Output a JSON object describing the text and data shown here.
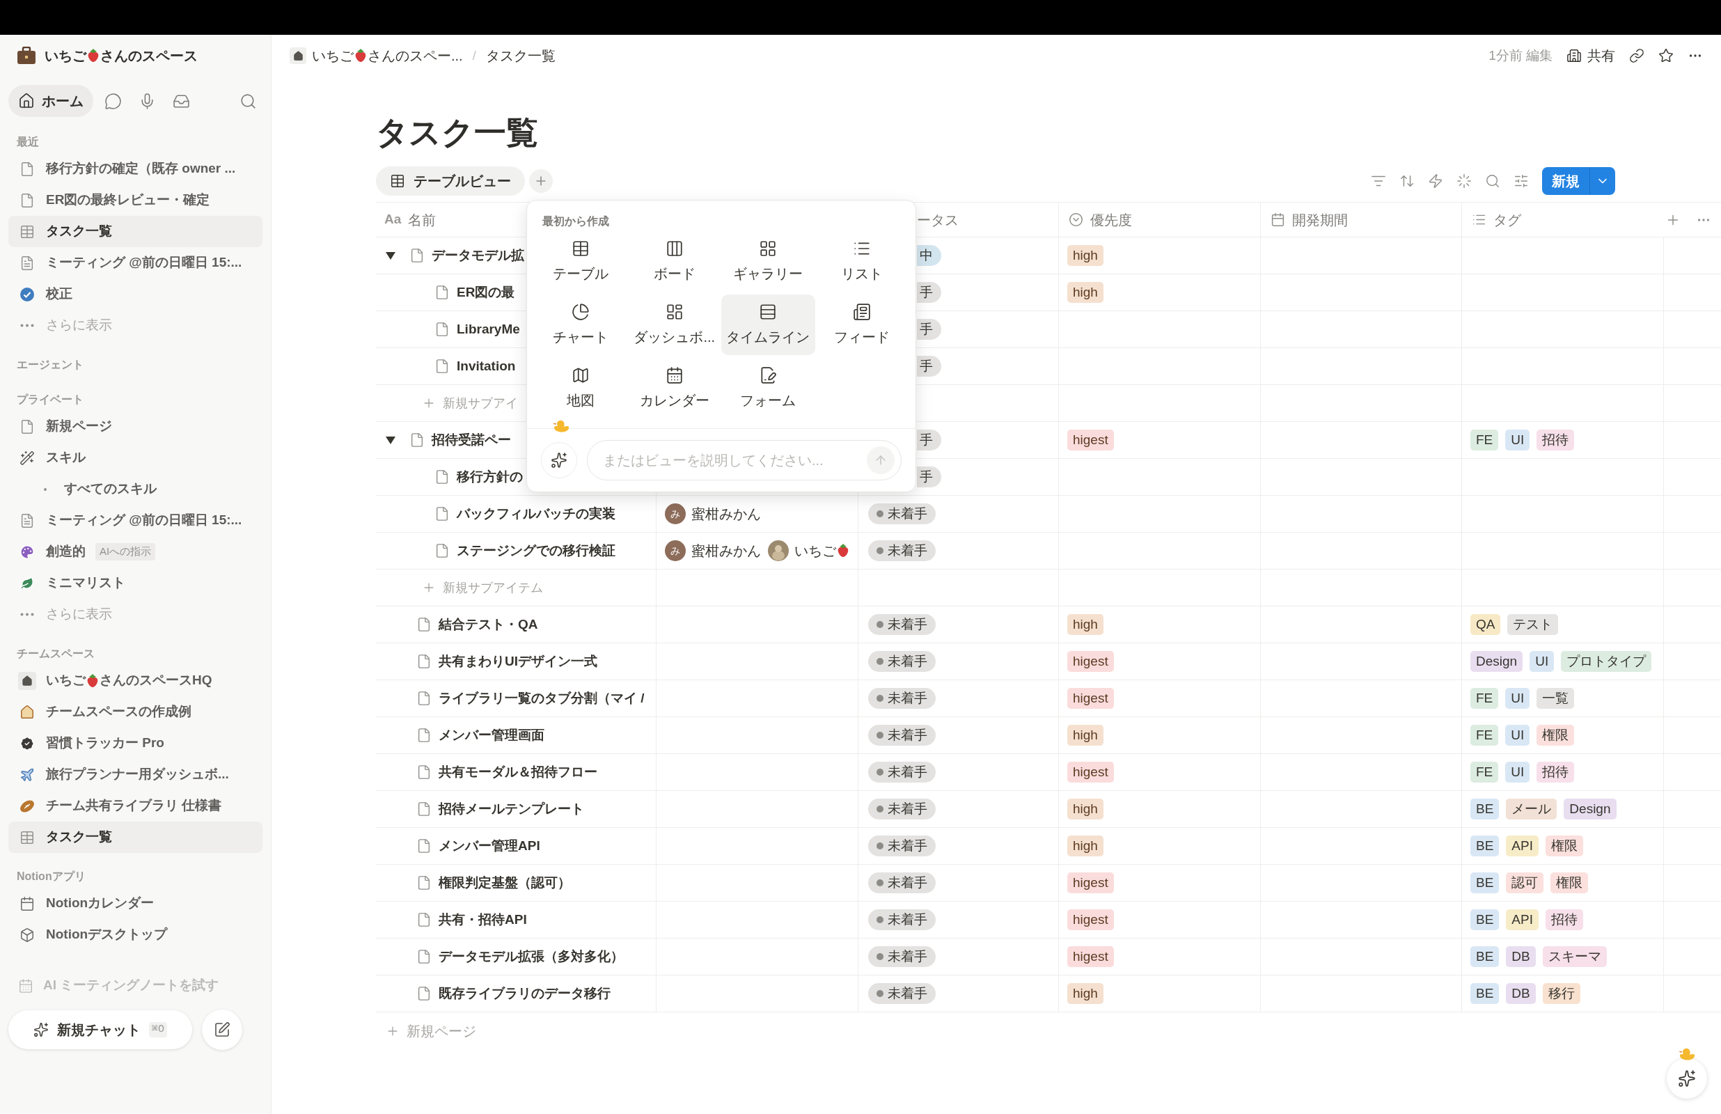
{
  "sidebar": {
    "workspace": {
      "label_parts": [
        "いちご",
        "さんのスペース"
      ]
    },
    "nav": [
      {
        "kind": "home",
        "label": "ホーム",
        "selected": true
      },
      {
        "kind": "chat",
        "selected": false
      },
      {
        "kind": "meeting",
        "selected": false
      },
      {
        "kind": "inbox",
        "selected": false
      },
      {
        "kind": "search",
        "selected": false
      }
    ],
    "sections": [
      {
        "heading": "最近",
        "items": [
          {
            "kind": "page",
            "label": "移行方針の確定（既存 owner ...",
            "selected": false
          },
          {
            "kind": "page",
            "label": "ER図の最終レビュー・確定",
            "selected": false
          },
          {
            "kind": "table",
            "label": "タスク一覧",
            "selected": true
          },
          {
            "kind": "meeting",
            "label": "ミーティング @前の日曜日 15:...",
            "selected": false
          },
          {
            "kind": "check",
            "label": "校正",
            "selected": false
          },
          {
            "kind": "more",
            "label": "さらに表示",
            "selected": false
          }
        ]
      },
      {
        "heading": "エージェント"
      },
      {
        "heading": "プライベート",
        "items": [
          {
            "kind": "page",
            "label": "新規ページ",
            "selected": false
          },
          {
            "kind": "skill",
            "label": "スキル",
            "selected": false
          },
          {
            "kind": "bullet",
            "label": "すべてのスキル",
            "selected": false
          },
          {
            "kind": "meeting",
            "label": "ミーティング @前の日曜日 15:...",
            "selected": false
          },
          {
            "kind": "palette",
            "label": "創造的",
            "badge": "AIへの指示",
            "selected": false
          },
          {
            "kind": "leaf",
            "label": "ミニマリスト",
            "selected": false
          },
          {
            "kind": "more",
            "label": "さらに表示",
            "selected": false
          }
        ]
      },
      {
        "heading": "チームスペース",
        "items": [
          {
            "kind": "home",
            "label_parts": [
              "いちご",
              "さんのスペースHQ"
            ],
            "selected": false
          },
          {
            "kind": "house",
            "label": "チームスペースの作成例",
            "selected": false
          },
          {
            "kind": "badge",
            "label": "習慣トラッカー Pro",
            "selected": false
          },
          {
            "kind": "plane",
            "label": "旅行プランナー用ダッシュボ...",
            "selected": false
          },
          {
            "kind": "football",
            "label": "チーム共有ライブラリ 仕様書",
            "selected": false
          },
          {
            "kind": "table",
            "label": "タスク一覧",
            "selected": true
          }
        ]
      },
      {
        "heading": "Notionアプリ",
        "items": [
          {
            "kind": "calendar",
            "label": "Notionカレンダー",
            "selected": false
          },
          {
            "kind": "app",
            "label": "Notionデスクトップ",
            "selected": false
          }
        ]
      }
    ],
    "ai_notes": {
      "label": "AI ミーティングノートを試す",
      "disabled": true
    },
    "new_chat": {
      "label": "新規チャット",
      "shortcut": "⌘O"
    }
  },
  "breadcrumb": {
    "separator": "/",
    "items": [
      {
        "kind": "workspace",
        "label_parts": [
          "いちご",
          "さんのスペー..."
        ]
      },
      {
        "kind": "page",
        "label": "タスク一覧"
      }
    ]
  },
  "header_actions": {
    "edited": "1分前 編集",
    "share": "共有"
  },
  "page_title": "タスク一覧",
  "views": [
    {
      "label": "テーブルビュー",
      "selected": true
    }
  ],
  "new_button": "新規",
  "columns": [
    {
      "kind": "title",
      "icon_text": "Aa",
      "label": "名前"
    },
    {
      "kind": "person"
    },
    {
      "kind": "status",
      "label": "ータス"
    },
    {
      "kind": "select",
      "label": "優先度"
    },
    {
      "kind": "date",
      "label": "開発期間"
    },
    {
      "kind": "multi",
      "label": "タグ"
    }
  ],
  "rows": [
    {
      "kind": "group",
      "expanded": true,
      "under_popup": true,
      "name": "データモデル拡",
      "status": {
        "label": "中",
        "color": "#d3e5ef"
      },
      "priority": {
        "label": "high",
        "color": "#f5e0cf"
      }
    },
    {
      "kind": "child",
      "under_popup": true,
      "name": "ER図の最",
      "status": {
        "label": "手",
        "color": "#e3e2e0"
      },
      "priority": {
        "label": "high",
        "color": "#f5e0cf"
      }
    },
    {
      "kind": "child",
      "under_popup": true,
      "name": "LibraryMe",
      "status": {
        "label": "手",
        "color": "#e3e2e0"
      }
    },
    {
      "kind": "child",
      "under_popup": true,
      "name": "Invitation",
      "status": {
        "label": "手",
        "color": "#e3e2e0"
      }
    },
    {
      "kind": "add",
      "name": "新規サブアイ"
    },
    {
      "kind": "group",
      "expanded": true,
      "under_popup": true,
      "name": "招待受諾ペー",
      "status": {
        "label": "手",
        "color": "#e3e2e0"
      },
      "priority": {
        "label": "higest",
        "color": "#fbdcdc"
      },
      "tags": [
        {
          "label": "FE",
          "color": "#dcece0"
        },
        {
          "label": "UI",
          "color": "#d9e7f5"
        },
        {
          "label": "招待",
          "color": "#f7e0ea"
        }
      ]
    },
    {
      "kind": "child",
      "under_popup": true,
      "name": "移行方針の",
      "status": {
        "label": "手",
        "color": "#e3e2e0"
      }
    },
    {
      "kind": "child",
      "under_popup": false,
      "name": "バックフィルバッチの実装",
      "assignees": [
        {
          "kind": "initial",
          "initial": "み",
          "name": "蜜柑みかん"
        }
      ],
      "status": {
        "label": "未着手",
        "color": "#e3e2e0"
      }
    },
    {
      "kind": "child",
      "under_popup": false,
      "name": "ステージングでの移行検証",
      "assignees": [
        {
          "kind": "initial",
          "initial": "み",
          "name": "蜜柑みかん"
        },
        {
          "kind": "photo",
          "name_parts": [
            "いちご"
          ],
          "emoji_after": true
        }
      ],
      "status": {
        "label": "未着手",
        "color": "#e3e2e0"
      }
    },
    {
      "kind": "add",
      "name": "新規サブアイテム"
    },
    {
      "kind": "page",
      "under_popup": false,
      "name": "結合テスト・QA",
      "status": {
        "label": "未着手",
        "color": "#e3e2e0"
      },
      "priority": {
        "label": "high",
        "color": "#f5e0cf"
      },
      "tags": [
        {
          "label": "QA",
          "color": "#f7e9c5"
        },
        {
          "label": "テスト",
          "color": "#e6e5e3"
        }
      ]
    },
    {
      "kind": "page",
      "under_popup": false,
      "name": "共有まわりUIデザイン一式",
      "status": {
        "label": "未着手",
        "color": "#e3e2e0"
      },
      "priority": {
        "label": "higest",
        "color": "#fbdcdc"
      },
      "tags": [
        {
          "label": "Design",
          "color": "#e8def0"
        },
        {
          "label": "UI",
          "color": "#d9e7f5"
        },
        {
          "label": "プロトタイプ",
          "color": "#dcece0"
        }
      ]
    },
    {
      "kind": "page",
      "under_popup": false,
      "name": "ライブラリ一覧のタブ分割（マイ /",
      "status": {
        "label": "未着手",
        "color": "#e3e2e0"
      },
      "priority": {
        "label": "higest",
        "color": "#fbdcdc"
      },
      "tags": [
        {
          "label": "FE",
          "color": "#dcece0"
        },
        {
          "label": "UI",
          "color": "#d9e7f5"
        },
        {
          "label": "一覧",
          "color": "#e6e5e3"
        }
      ]
    },
    {
      "kind": "page",
      "under_popup": false,
      "name": "メンバー管理画面",
      "status": {
        "label": "未着手",
        "color": "#e3e2e0"
      },
      "priority": {
        "label": "high",
        "color": "#f5e0cf"
      },
      "tags": [
        {
          "label": "FE",
          "color": "#dcece0"
        },
        {
          "label": "UI",
          "color": "#d9e7f5"
        },
        {
          "label": "権限",
          "color": "#fbe0dd"
        }
      ]
    },
    {
      "kind": "page",
      "under_popup": false,
      "name": "共有モーダル＆招待フロー",
      "status": {
        "label": "未着手",
        "color": "#e3e2e0"
      },
      "priority": {
        "label": "higest",
        "color": "#fbdcdc"
      },
      "tags": [
        {
          "label": "FE",
          "color": "#dcece0"
        },
        {
          "label": "UI",
          "color": "#d9e7f5"
        },
        {
          "label": "招待",
          "color": "#f7e0ea"
        }
      ]
    },
    {
      "kind": "page",
      "under_popup": false,
      "name": "招待メールテンプレート",
      "status": {
        "label": "未着手",
        "color": "#e3e2e0"
      },
      "priority": {
        "label": "high",
        "color": "#f5e0cf"
      },
      "tags": [
        {
          "label": "BE",
          "color": "#d9e7f5"
        },
        {
          "label": "メール",
          "color": "#f2e1d6"
        },
        {
          "label": "Design",
          "color": "#e8def0"
        }
      ]
    },
    {
      "kind": "page",
      "under_popup": false,
      "name": "メンバー管理API",
      "status": {
        "label": "未着手",
        "color": "#e3e2e0"
      },
      "priority": {
        "label": "high",
        "color": "#f5e0cf"
      },
      "tags": [
        {
          "label": "BE",
          "color": "#d9e7f5"
        },
        {
          "label": "API",
          "color": "#f7ecc8"
        },
        {
          "label": "権限",
          "color": "#fbe0dd"
        }
      ]
    },
    {
      "kind": "page",
      "under_popup": false,
      "name": "権限判定基盤（認可）",
      "status": {
        "label": "未着手",
        "color": "#e3e2e0"
      },
      "priority": {
        "label": "higest",
        "color": "#fbdcdc"
      },
      "tags": [
        {
          "label": "BE",
          "color": "#d9e7f5"
        },
        {
          "label": "認可",
          "color": "#fbe0dd"
        },
        {
          "label": "権限",
          "color": "#fbe0dd"
        }
      ]
    },
    {
      "kind": "page",
      "under_popup": false,
      "name": "共有・招待API",
      "status": {
        "label": "未着手",
        "color": "#e3e2e0"
      },
      "priority": {
        "label": "higest",
        "color": "#fbdcdc"
      },
      "tags": [
        {
          "label": "BE",
          "color": "#d9e7f5"
        },
        {
          "label": "API",
          "color": "#f7ecc8"
        },
        {
          "label": "招待",
          "color": "#f7e0ea"
        }
      ]
    },
    {
      "kind": "page",
      "under_popup": false,
      "name": "データモデル拡張（多対多化）",
      "status": {
        "label": "未着手",
        "color": "#e3e2e0"
      },
      "priority": {
        "label": "higest",
        "color": "#fbdcdc"
      },
      "tags": [
        {
          "label": "BE",
          "color": "#d9e7f5"
        },
        {
          "label": "DB",
          "color": "#e8def0"
        },
        {
          "label": "スキーマ",
          "color": "#f7e0ea"
        }
      ]
    },
    {
      "kind": "page",
      "under_popup": false,
      "name": "既存ライブラリのデータ移行",
      "status": {
        "label": "未着手",
        "color": "#e3e2e0"
      },
      "priority": {
        "label": "high",
        "color": "#f5e0cf"
      },
      "tags": [
        {
          "label": "BE",
          "color": "#d9e7f5"
        },
        {
          "label": "DB",
          "color": "#e8def0"
        },
        {
          "label": "移行",
          "color": "#f8e1cf"
        }
      ]
    }
  ],
  "add_page": "新規ページ",
  "create_menu": {
    "heading": "最初から作成",
    "items": [
      {
        "kind": "table",
        "label": "テーブル",
        "selected": false
      },
      {
        "kind": "board",
        "label": "ボード",
        "selected": false
      },
      {
        "kind": "gallery",
        "label": "ギャラリー",
        "selected": false
      },
      {
        "kind": "list",
        "label": "リスト",
        "selected": false
      },
      {
        "kind": "chart",
        "label": "チャート",
        "selected": false
      },
      {
        "kind": "dashboard",
        "label": "ダッシュボ...",
        "selected": false
      },
      {
        "kind": "timeline",
        "label": "タイムライン",
        "selected": true
      },
      {
        "kind": "feed",
        "label": "フィード",
        "selected": false
      },
      {
        "kind": "map",
        "label": "地図",
        "selected": false
      },
      {
        "kind": "calendar",
        "label": "カレンダー",
        "selected": false
      },
      {
        "kind": "form",
        "label": "フォーム",
        "selected": false
      }
    ],
    "prompt": {
      "placeholder": "またはビューを説明してください..."
    }
  }
}
